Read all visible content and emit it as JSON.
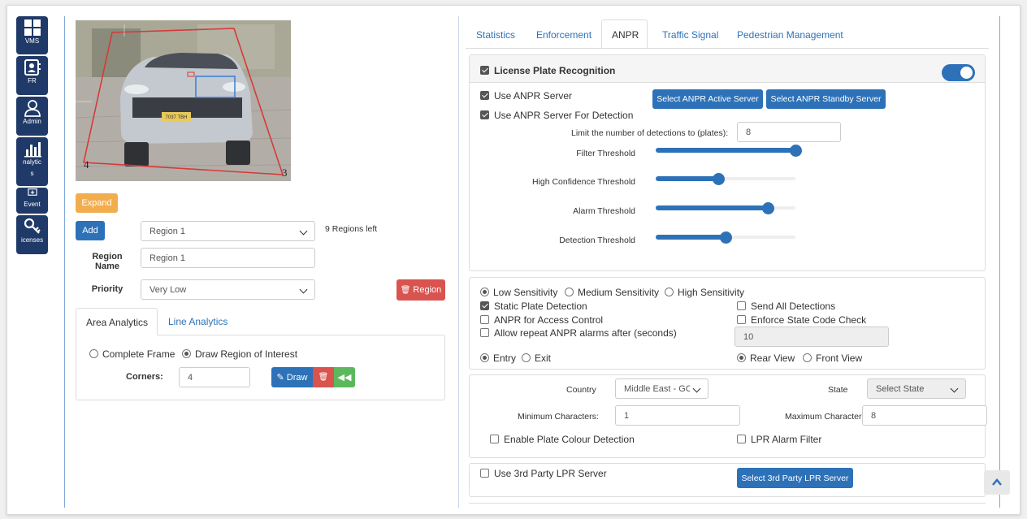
{
  "sidebar": {
    "items": [
      {
        "label": "VMS",
        "icon": "grid-icon"
      },
      {
        "label": "FR",
        "icon": "contact-card-icon"
      },
      {
        "label": "Admin",
        "icon": "user-icon"
      },
      {
        "label": "nalytic",
        "label2": "s",
        "icon": "bar-chart-icon"
      },
      {
        "label": "Event",
        "icon": "event-plus-icon"
      },
      {
        "label": "icenses",
        "icon": "key-icon"
      }
    ]
  },
  "camera": {
    "corner_4": "4",
    "corner_3": "3",
    "plate_text": "7037 TBH"
  },
  "left": {
    "expand_label": "Expand",
    "add_label": "Add",
    "region_select": "Region 1",
    "regions_left": "9 Regions left",
    "region_name_label": "Region Name",
    "region_name_value": "Region 1",
    "priority_label": "Priority",
    "priority_value": "Very Low",
    "delete_region_label": "Region",
    "tabs": [
      "Area Analytics",
      "Line Analytics"
    ],
    "complete_frame": "Complete Frame",
    "draw_roi": "Draw Region of Interest",
    "corners_label": "Corners:",
    "corners_value": "4",
    "draw_label": "Draw"
  },
  "tabs": [
    "Statistics",
    "Enforcement",
    "ANPR",
    "Traffic Signal",
    "Pedestrian Management"
  ],
  "lpr": {
    "title": "License Plate Recognition",
    "toggle_on": true,
    "use_server": "Use ANPR Server",
    "use_server_detect": "Use ANPR Server For Detection",
    "active_server_btn": "Select ANPR Active Server",
    "standby_server_btn": "Select ANPR Standby Server",
    "limit_label": "Limit the number of detections to (plates):",
    "limit_value": "8",
    "thresholds": [
      {
        "label": "Filter Threshold",
        "value": 1.0
      },
      {
        "label": "High Confidence Threshold",
        "value": 0.45
      },
      {
        "label": "Alarm Threshold",
        "value": 0.8
      },
      {
        "label": "Detection Threshold",
        "value": 0.5
      }
    ]
  },
  "sensitivity": {
    "low": "Low Sensitivity",
    "medium": "Medium Sensitivity",
    "high": "High Sensitivity",
    "static_plate": "Static Plate Detection",
    "send_all": "Send All Detections",
    "access_control": "ANPR for Access Control",
    "state_code": "Enforce State Code Check",
    "repeat_alarms": "Allow repeat ANPR alarms after (seconds)",
    "repeat_value": "10",
    "entry": "Entry",
    "exit": "Exit",
    "rear_view": "Rear View",
    "front_view": "Front View"
  },
  "region": {
    "country_label": "Country",
    "country_value": "Middle East - GCC",
    "state_label": "State",
    "state_value": "Select State",
    "min_chars_label": "Minimum Characters:",
    "min_chars_value": "1",
    "max_chars_label": "Maximum Characters:",
    "max_chars_value": "8",
    "plate_colour": "Enable Plate Colour Detection",
    "lpr_alarm_filter": "LPR Alarm Filter"
  },
  "third_party": {
    "label": "Use 3rd Party LPR Server",
    "button": "Select 3rd Party LPR Server"
  },
  "colors": {
    "primary": "#2d72b8",
    "sidebar": "#1f3a68",
    "warning": "#f2ad4e",
    "danger": "#d9534f",
    "success": "#5cb85c"
  }
}
